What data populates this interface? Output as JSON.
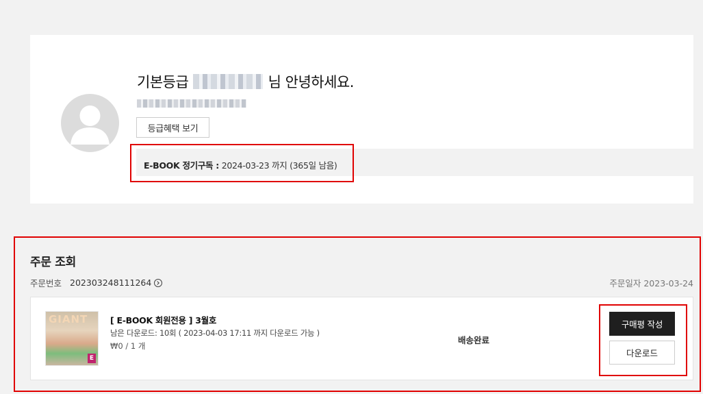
{
  "profile": {
    "greeting_prefix": "기본등급",
    "greeting_suffix": "님 안녕하세요.",
    "grade_button_label": "등급혜택 보기",
    "subscription": {
      "label": "E-BOOK 정기구독 :",
      "detail": "2024-03-23 까지 (365일 남음)"
    }
  },
  "orders": {
    "section_title": "주문 조회",
    "order_number_label": "주문번호",
    "order_number": "202303248111264",
    "order_date_label": "주문일자",
    "order_date": "2023-03-24",
    "item": {
      "thumbnail_masthead": "GIANT",
      "thumbnail_badge": "E",
      "title": "[ E-BOOK 회원전용 ] 3월호",
      "remaining": "남은 다운로드: 10회 ( 2023-04-03 17:11 까지 다운로드 가능 )",
      "price": "₩0 / 1 개",
      "status": "배송완료",
      "review_button": "구매평 작성",
      "download_button": "다운로드"
    }
  },
  "icons": {
    "avatar": "user-silhouette-icon",
    "order_link": "circle-arrow-right-icon"
  },
  "colors": {
    "highlight": "#e00000",
    "primary_button": "#1f1f1f",
    "background": "#f2f2f2"
  }
}
